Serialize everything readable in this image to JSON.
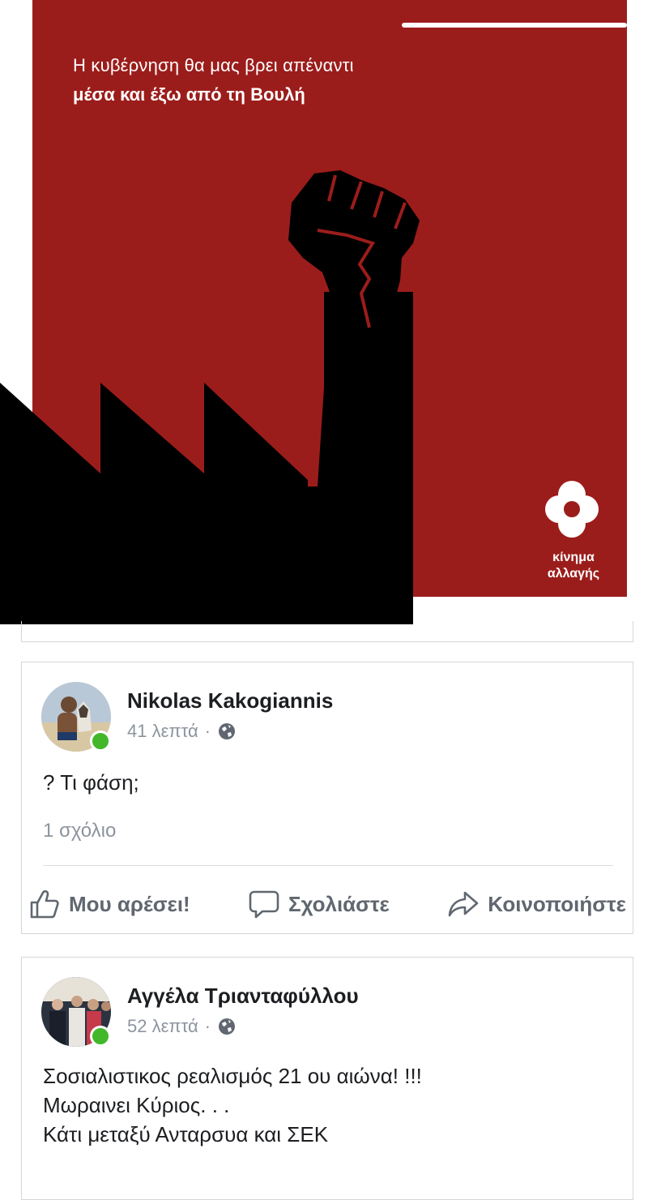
{
  "poster": {
    "line1": "Η κυβέρνηση θα μας βρει απέναντι",
    "line2": "μέσα και έξω από τη Βουλή",
    "logo_line1": "κίνημα",
    "logo_line2": "αλλαγής",
    "bg_color": "#9b1d1b",
    "logo_icon": "kinal-logo-icon",
    "art": "raised-fist-factory-illustration"
  },
  "comments": [
    {
      "author": "Nikolas Kakogiannis",
      "time": "41 λεπτά",
      "separator": "·",
      "privacy_icon": "globe-icon",
      "text": "? Τι φάση;",
      "count_label": "1 σχόλιο",
      "actions": {
        "like": "Μου αρέσει!",
        "comment": "Σχολιάστε",
        "share": "Κοινοποιήστε"
      }
    },
    {
      "author": "Αγγέλα Τριανταφύλλου",
      "time": "52 λεπτά",
      "separator": "·",
      "privacy_icon": "globe-icon",
      "text_lines": [
        "Σοσιαλιστικος ρεαλισμός 21 ου αιώνα! !!!",
        "Μωραινει Κύριος. . .",
        "Κάτι μεταξύ Ανταρσυα και ΣΕΚ"
      ]
    }
  ],
  "colors": {
    "online": "#42b72a",
    "muted_text": "#8d949e",
    "action_text": "#606770"
  }
}
